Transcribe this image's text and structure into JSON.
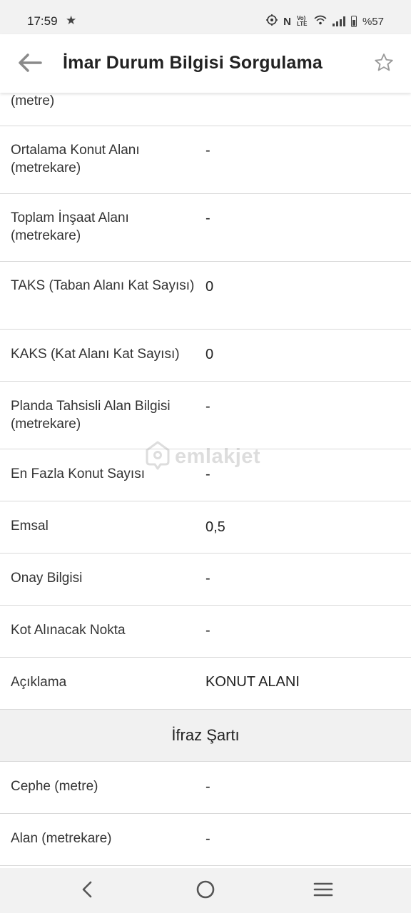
{
  "status_bar": {
    "time": "17:59",
    "battery_text": "%57",
    "net_label": "Vo) LTE"
  },
  "app_bar": {
    "title": "İmar Durum Bilgisi Sorgulama",
    "back_icon": "arrow-left-icon",
    "favorite_icon": "star-outline-icon"
  },
  "rows_top": [
    {
      "label": "(metre)",
      "value": ""
    },
    {
      "label": "Ortalama Konut Alanı (metrekare)",
      "value": "-"
    },
    {
      "label": "Toplam İnşaat Alanı (metrekare)",
      "value": "-"
    },
    {
      "label": "TAKS (Taban Alanı Kat Sayısı)",
      "value": "0"
    },
    {
      "label": "KAKS (Kat Alanı Kat Sayısı)",
      "value": "0"
    },
    {
      "label": "Planda Tahsisli Alan Bilgisi (metrekare)",
      "value": "-"
    },
    {
      "label": "En Fazla Konut Sayısı",
      "value": "-"
    },
    {
      "label": "Emsal",
      "value": "0,5"
    },
    {
      "label": "Onay Bilgisi",
      "value": "-"
    },
    {
      "label": "Kot Alınacak Nokta",
      "value": "-"
    },
    {
      "label": "Açıklama",
      "value": "KONUT ALANI"
    }
  ],
  "section_ifraz": {
    "title": "İfraz Şartı",
    "rows": [
      {
        "label": "Cephe (metre)",
        "value": "-"
      },
      {
        "label": "Alan (metrekare)",
        "value": "-"
      }
    ]
  },
  "watermark": {
    "text": "emlakjet"
  },
  "colors": {
    "divider": "#d9d9d9",
    "section_bg": "#f1f1f1",
    "status_bg": "#f2f2f2",
    "text": "#222222"
  }
}
